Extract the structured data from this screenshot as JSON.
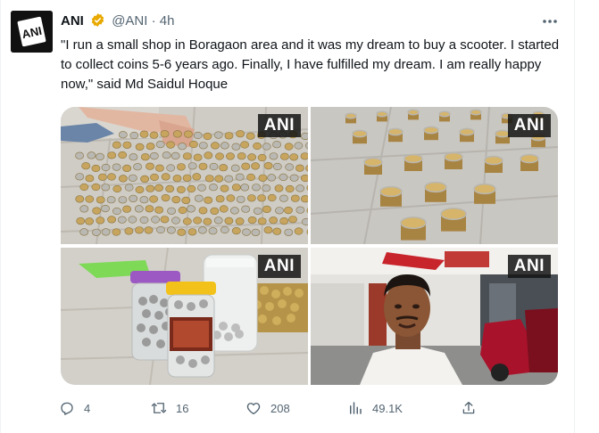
{
  "tweet": {
    "author_name": "ANI",
    "handle": "@ANI",
    "separator": "·",
    "time": "4h",
    "text": "\"I run a small shop in Boragaon area and it was my dream to buy a scooter. I started to collect coins 5-6 years ago. Finally, I have fulfilled my dream. I am really happy now,\" said Md Saidul Hoque",
    "avatar_logo_text": "ANI"
  },
  "media": {
    "watermark": "ANI",
    "photos": [
      {
        "alt": "coins spread on floor"
      },
      {
        "alt": "stacks of coins"
      },
      {
        "alt": "coin jars"
      },
      {
        "alt": "man in scooter showroom"
      }
    ]
  },
  "actions": {
    "reply_count": "4",
    "retweet_count": "16",
    "like_count": "208",
    "views_count": "49.1K"
  },
  "colors": {
    "text": "#0f1419",
    "secondary": "#536471",
    "verified": "#e8a900"
  },
  "icons": [
    "more-icon",
    "verified-badge-icon",
    "reply-icon",
    "retweet-icon",
    "like-icon",
    "views-icon",
    "share-icon"
  ]
}
